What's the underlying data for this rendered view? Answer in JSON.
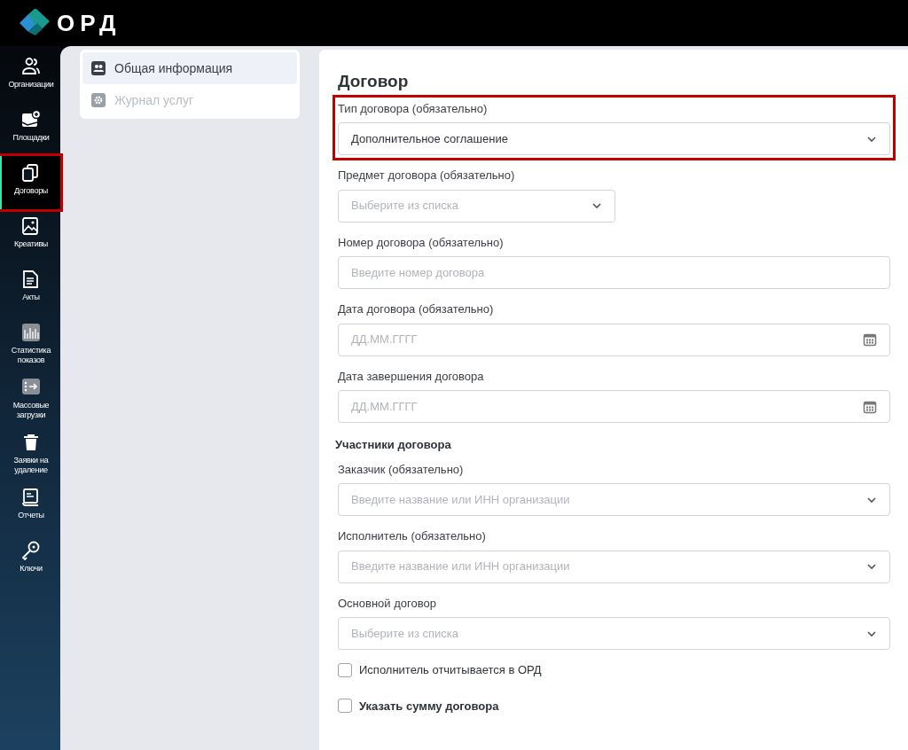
{
  "logo": {
    "text": "ОРД"
  },
  "sidebar": {
    "items": [
      {
        "label": "Организации",
        "selected": false,
        "highlighted": false
      },
      {
        "label": "Площадки",
        "selected": false,
        "highlighted": false
      },
      {
        "label": "Договоры",
        "selected": true,
        "highlighted": true
      },
      {
        "label": "Креативы",
        "selected": false,
        "highlighted": false
      },
      {
        "label": "Акты",
        "selected": false,
        "highlighted": false
      },
      {
        "label": "Статистика показов",
        "selected": false,
        "highlighted": false
      },
      {
        "label": "Массовые загрузки",
        "selected": false,
        "highlighted": false
      },
      {
        "label": "Заявки на удаление",
        "selected": false,
        "highlighted": false
      },
      {
        "label": "Отчеты",
        "selected": false,
        "highlighted": false
      },
      {
        "label": "Ключи",
        "selected": false,
        "highlighted": false
      }
    ]
  },
  "sections": [
    {
      "label": "Общая информация",
      "selected": true,
      "disabled": false
    },
    {
      "label": "Журнал услуг",
      "selected": false,
      "disabled": true
    }
  ],
  "form": {
    "title": "Договор",
    "items": [
      {
        "kind": "select",
        "label": "Тип договора (обязательно)",
        "value": "Дополнительное соглашение",
        "highlighted": true
      },
      {
        "kind": "short-select",
        "label": "Предмет договора (обязательно)",
        "placeholder": "Выберите из списка"
      },
      {
        "kind": "input",
        "label": "Номер договора (обязательно)",
        "placeholder": "Введите номер договора"
      },
      {
        "kind": "date",
        "label": "Дата договора (обязательно)",
        "placeholder": "ДД.ММ.ГГГГ"
      },
      {
        "kind": "date",
        "label": "Дата завершения договора",
        "placeholder": "ДД.ММ.ГГГГ"
      },
      {
        "kind": "heading",
        "label": "Участники договора"
      },
      {
        "kind": "select",
        "label": "Заказчик (обязательно)",
        "placeholder": "Введите название или ИНН организации"
      },
      {
        "kind": "select",
        "label": "Исполнитель (обязательно)",
        "placeholder": "Введите название или ИНН организации"
      },
      {
        "kind": "select",
        "label": "Основной договор",
        "placeholder": "Выберите из списка"
      },
      {
        "kind": "checkbox",
        "label": "Исполнитель отчитывается в ОРД",
        "checked": false,
        "bold": false
      },
      {
        "kind": "checkbox",
        "label": "Указать сумму договора",
        "checked": false,
        "bold": true
      }
    ]
  }
}
